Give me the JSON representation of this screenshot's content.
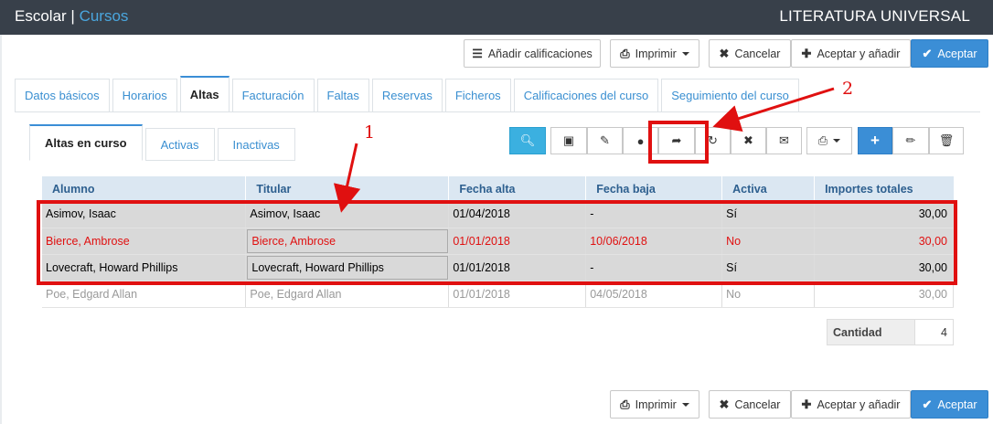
{
  "header": {
    "app": "Escolar",
    "separator": " | ",
    "section": "Cursos",
    "course": "LITERATURA UNIVERSAL"
  },
  "top_actions": {
    "add_grades": "Añadir calificaciones",
    "print": "Imprimir",
    "cancel": "Cancelar",
    "accept_add": "Aceptar y añadir",
    "accept": "Aceptar"
  },
  "tabs": [
    "Datos básicos",
    "Horarios",
    "Altas",
    "Facturación",
    "Faltas",
    "Reservas",
    "Ficheros",
    "Calificaciones del curso",
    "Seguimiento del curso"
  ],
  "subtabs": [
    "Altas en curso",
    "Activas",
    "Inactivas"
  ],
  "columns": [
    "Alumno",
    "Titular",
    "Fecha alta",
    "Fecha baja",
    "Activa",
    "Importes totales"
  ],
  "rows": [
    {
      "alumno": "Asimov, Isaac",
      "titular": "Asimov, Isaac",
      "alta": "01/04/2018",
      "baja": "-",
      "activa": "Sí",
      "importe": "30,00"
    },
    {
      "alumno": "Bierce, Ambrose",
      "titular": "Bierce, Ambrose",
      "alta": "01/01/2018",
      "baja": "10/06/2018",
      "activa": "No",
      "importe": "30,00"
    },
    {
      "alumno": "Lovecraft, Howard Phillips",
      "titular": "Lovecraft, Howard Phillips",
      "alta": "01/01/2018",
      "baja": "-",
      "activa": "Sí",
      "importe": "30,00"
    },
    {
      "alumno": "Poe, Edgard Allan",
      "titular": "Poe, Edgard Allan",
      "alta": "01/01/2018",
      "baja": "04/05/2018",
      "activa": "No",
      "importe": "30,00"
    }
  ],
  "summary": {
    "label": "Cantidad",
    "value": "4"
  },
  "annotations": {
    "one": "1",
    "two": "2"
  },
  "colors": {
    "accent": "#3b8ed6",
    "highlight": "#e01010",
    "topbar": "#38404a"
  }
}
